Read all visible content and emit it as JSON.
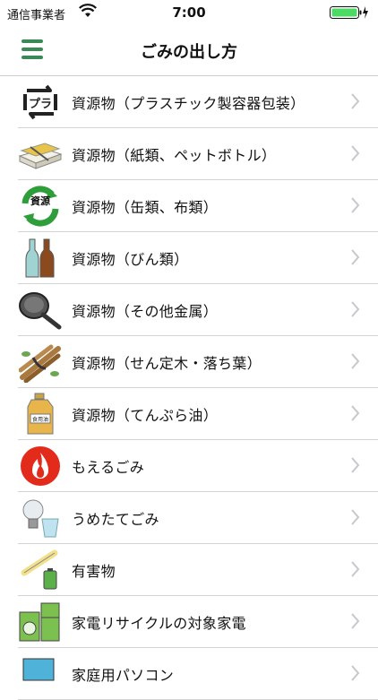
{
  "status": {
    "carrier": "通信事業者",
    "time": "7:00"
  },
  "header": {
    "title": "ごみの出し方"
  },
  "items": [
    {
      "label": "資源物（プラスチック製容器包装）",
      "icon": "plastic-recycle-icon",
      "icon_text": "プラ"
    },
    {
      "label": "資源物（紙類、ペットボトル）",
      "icon": "paper-bundle-icon"
    },
    {
      "label": "資源物（缶類、布類）",
      "icon": "resource-recycle-icon",
      "icon_text": "資源"
    },
    {
      "label": "資源物（びん類）",
      "icon": "bottles-icon"
    },
    {
      "label": "資源物（その他金属）",
      "icon": "frying-pan-icon"
    },
    {
      "label": "資源物（せん定木・落ち葉）",
      "icon": "branches-icon"
    },
    {
      "label": "資源物（てんぷら油）",
      "icon": "oil-bottle-icon",
      "icon_text": "食用油"
    },
    {
      "label": "もえるごみ",
      "icon": "fire-icon"
    },
    {
      "label": "うめたてごみ",
      "icon": "bulb-glass-icon"
    },
    {
      "label": "有害物",
      "icon": "battery-fluorescent-icon"
    },
    {
      "label": "家電リサイクルの対象家電",
      "icon": "appliances-icon"
    },
    {
      "label": "家庭用パソコン",
      "icon": "computer-icon"
    }
  ],
  "colors": {
    "accent": "#3a8a58",
    "battery": "#4cd964"
  }
}
